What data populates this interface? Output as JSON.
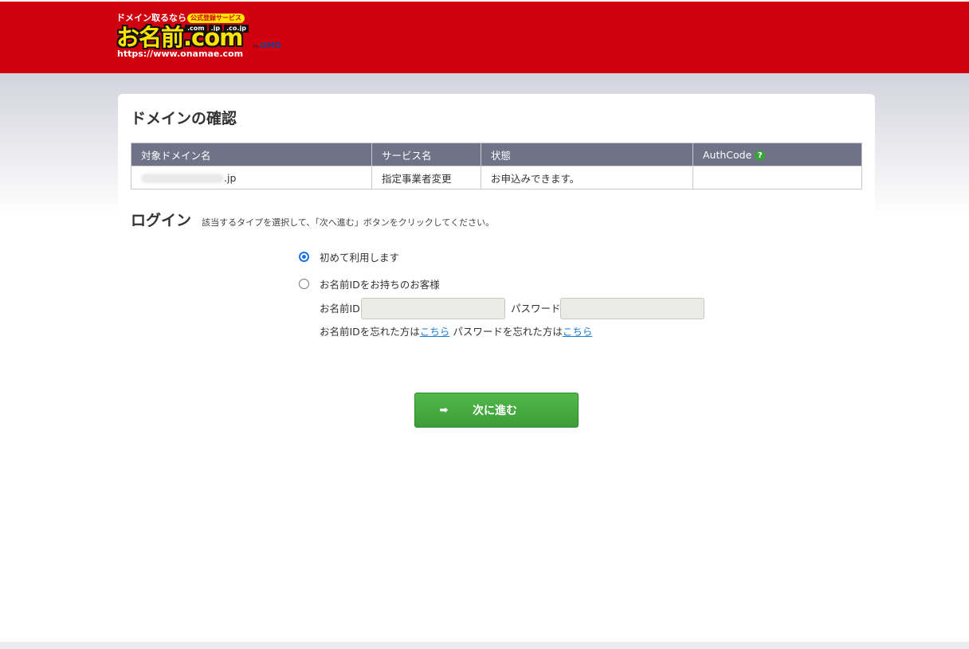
{
  "header": {
    "tagline": "ドメイン取るなら",
    "badge": "公式登録サービス",
    "tlds": [
      ".com",
      ".jp",
      ".co.jp"
    ],
    "brand": "お名前.com",
    "url": "https://www.onamae.com",
    "by": "by",
    "gmo": "GMO",
    "brand_color": "#d0000f"
  },
  "confirm": {
    "title": "ドメインの確認",
    "columns": [
      "対象ドメイン名",
      "サービス名",
      "状態",
      "AuthCode"
    ],
    "help_icon": "?",
    "row": {
      "domain_suffix": ".jp",
      "service": "指定事業者変更",
      "status": "お申込みできます。",
      "authcode": ""
    }
  },
  "login": {
    "title": "ログイン",
    "description": "該当するタイプを選択して、「次へ進む」ボタンをクリックしてください。",
    "option_new": "初めて利用します",
    "option_existing": "お名前IDをお持ちのお客様",
    "id_label": "お名前ID",
    "password_label": "パスワード",
    "id_value": "",
    "password_value": "",
    "forgot_id_text": "お名前IDを忘れた方は",
    "forgot_id_link": "こちら",
    "forgot_pw_text": "パスワードを忘れた方は",
    "forgot_pw_link": "こちら"
  },
  "next_button": {
    "label": "次に進む",
    "icon": "arrow-right-icon",
    "color": "#3e9d39"
  }
}
